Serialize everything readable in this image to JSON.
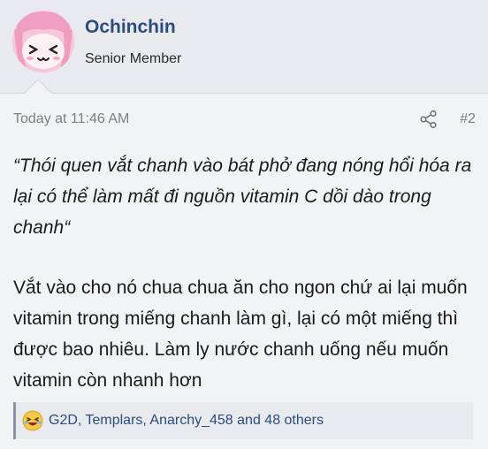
{
  "post": {
    "username": "Ochinchin",
    "user_title": "Senior Member",
    "timestamp": "Today at 11:46 AM",
    "post_number": "#2",
    "quote_text": "“Thói quen vắt chanh vào bát phở đang nóng hổi hóa ra lại có thể làm mất đi nguồn vitamin C dồi dào trong chanh“",
    "body_text": "Vắt vào cho nó chua chua ăn cho ngon chứ ai lại muốn vitamin trong miếng chanh làm gì, lại có một miếng thì được bao nhiêu. Làm ly nước chanh uống nếu muốn vitamin còn nhanh hơn"
  },
  "reactions": {
    "text": "G2D, Templars, Anarchy_458 and 48 others",
    "icon": "laugh-emoji-icon"
  },
  "icons": {
    "avatar": "anime-avatar-icon",
    "share": "share-icon"
  },
  "colors": {
    "username": "#2b4c7e",
    "meta": "#7b7f86",
    "header_bg": "#e9eaee",
    "page_bg": "#f2f3f5"
  }
}
